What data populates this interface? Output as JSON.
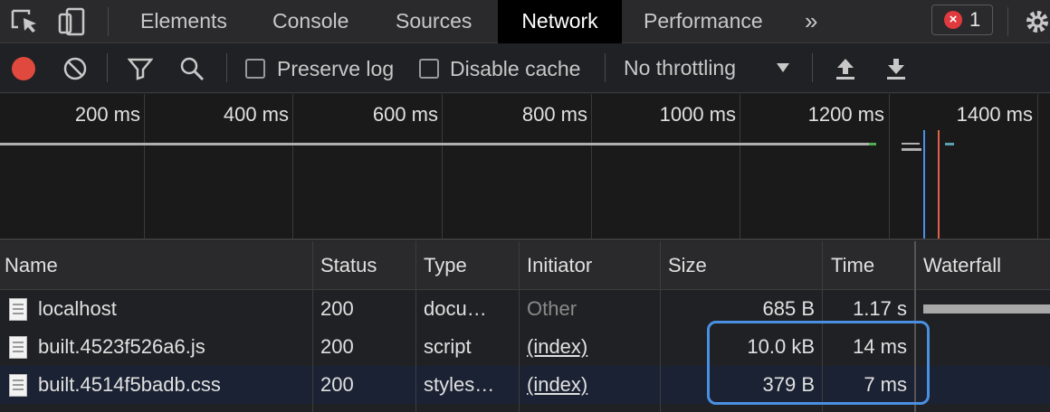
{
  "tabs": [
    "Elements",
    "Console",
    "Sources",
    "Network",
    "Performance"
  ],
  "more_tabs_label": "»",
  "error_count": "1",
  "toolbar": {
    "preserve_log": "Preserve log",
    "disable_cache": "Disable cache",
    "throttling": "No throttling"
  },
  "overview": {
    "ticks": [
      "200 ms",
      "400 ms",
      "600 ms",
      "800 ms",
      "1000 ms",
      "1200 ms",
      "1400 ms"
    ]
  },
  "table": {
    "columns": [
      "Name",
      "Status",
      "Type",
      "Initiator",
      "Size",
      "Time",
      "Waterfall"
    ],
    "rows": [
      {
        "name": "localhost",
        "status": "200",
        "type": "docu…",
        "initiator": "Other",
        "size": "685 B",
        "time": "1.17 s"
      },
      {
        "name": "built.4523f526a6.js",
        "status": "200",
        "type": "script",
        "initiator": "(index)",
        "size": "10.0 kB",
        "time": "14 ms"
      },
      {
        "name": "built.4514f5badb.css",
        "status": "200",
        "type": "styles…",
        "initiator": "(index)",
        "size": "379 B",
        "time": "7 ms"
      }
    ]
  },
  "colors": {
    "record": "#e0493e",
    "highlight": "#4a90e2",
    "active_tab_bg": "#000000"
  }
}
